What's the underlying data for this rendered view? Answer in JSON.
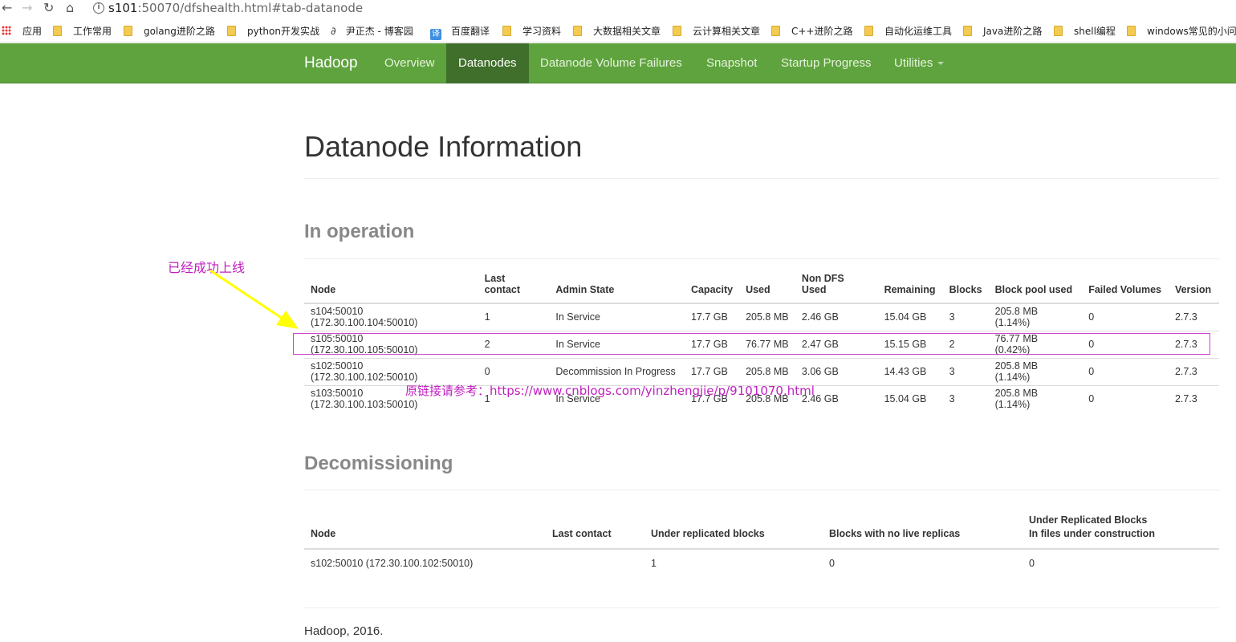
{
  "browser": {
    "url_host": "s101",
    "url_rest": ":50070/dfshealth.html#tab-datanode",
    "bookmarks": [
      {
        "label": "应用",
        "icon": "apps-grid-icon"
      },
      {
        "label": "工作常用",
        "icon": "folder-icon"
      },
      {
        "label": "golang进阶之路",
        "icon": "folder-icon"
      },
      {
        "label": "python开发实战",
        "icon": "folder-icon"
      },
      {
        "label": "尹正杰 - 博客园",
        "icon": "blog-icon"
      },
      {
        "label": "百度翻译",
        "icon": "translate-icon"
      },
      {
        "label": "学习资料",
        "icon": "folder-icon"
      },
      {
        "label": "大数据相关文章",
        "icon": "folder-icon"
      },
      {
        "label": "云计算相关文章",
        "icon": "folder-icon"
      },
      {
        "label": "C++进阶之路",
        "icon": "folder-icon"
      },
      {
        "label": "自动化运维工具",
        "icon": "folder-icon"
      },
      {
        "label": "Java进阶之路",
        "icon": "folder-icon"
      },
      {
        "label": "shell编程",
        "icon": "folder-icon"
      },
      {
        "label": "windows常见的小问",
        "icon": "folder-icon"
      }
    ]
  },
  "navbar": {
    "brand": "Hadoop",
    "items": [
      "Overview",
      "Datanodes",
      "Datanode Volume Failures",
      "Snapshot",
      "Startup Progress",
      "Utilities"
    ],
    "active": "Datanodes",
    "color": "#5fa33e",
    "active_color": "#3f6f2a"
  },
  "page": {
    "title": "Datanode Information",
    "in_operation_title": "In operation",
    "decommissioning_title": "Decomissioning",
    "footer": "Hadoop, 2016."
  },
  "in_operation": {
    "headers": [
      "Node",
      "Last contact",
      "Admin State",
      "Capacity",
      "Used",
      "Non DFS Used",
      "Remaining",
      "Blocks",
      "Block pool used",
      "Failed Volumes",
      "Version"
    ],
    "rows": [
      [
        "s104:50010 (172.30.100.104:50010)",
        "1",
        "In Service",
        "17.7 GB",
        "205.8 MB",
        "2.46 GB",
        "15.04 GB",
        "3",
        "205.8 MB (1.14%)",
        "0",
        "2.7.3"
      ],
      [
        "s105:50010 (172.30.100.105:50010)",
        "2",
        "In Service",
        "17.7 GB",
        "76.77 MB",
        "2.47 GB",
        "15.15 GB",
        "2",
        "76.77 MB (0.42%)",
        "0",
        "2.7.3"
      ],
      [
        "s102:50010 (172.30.100.102:50010)",
        "0",
        "Decommission In Progress",
        "17.7 GB",
        "205.8 MB",
        "3.06 GB",
        "14.43 GB",
        "3",
        "205.8 MB (1.14%)",
        "0",
        "2.7.3"
      ],
      [
        "s103:50010 (172.30.100.103:50010)",
        "1",
        "In Service",
        "17.7 GB",
        "205.8 MB",
        "2.46 GB",
        "15.04 GB",
        "3",
        "205.8 MB (1.14%)",
        "0",
        "2.7.3"
      ]
    ]
  },
  "decommissioning": {
    "headers": [
      "Node",
      "Last contact",
      "Under replicated blocks",
      "Blocks with no live replicas",
      "Under Replicated Blocks\nIn files under construction"
    ],
    "rows": [
      [
        "s102:50010 (172.30.100.102:50010)",
        "",
        "1",
        "0",
        "0"
      ]
    ]
  },
  "annotations": {
    "label": "已经成功上线",
    "watermark": "原链接请参考：https://www.cnblogs.com/yinzhengjie/p/9101070.html",
    "color": "#c020c0",
    "arrow_color": "#ffff00"
  }
}
